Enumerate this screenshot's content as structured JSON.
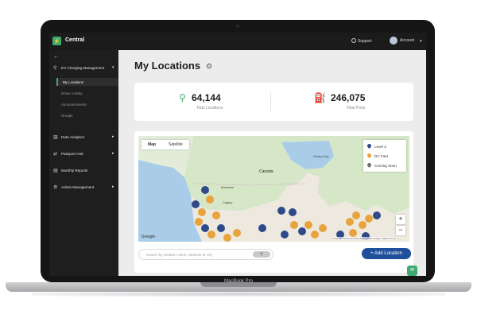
{
  "device": {
    "model_label": "MacBook Pro"
  },
  "app": {
    "name": "Central",
    "logo_glyph": "⚡"
  },
  "topbar": {
    "support_label": "Support",
    "account_label": "Account",
    "caret": "▾"
  },
  "sidebar": {
    "back_glyph": "←",
    "sections": [
      {
        "icon": "⚲",
        "label": "EV Charging Management",
        "caret": "▾"
      },
      {
        "icon": "▥",
        "label": "Data Analytics",
        "caret": "▸"
      },
      {
        "icon": "⇄",
        "label": "Passport Hub",
        "caret": "▸"
      },
      {
        "icon": "▤",
        "label": "Monthly Reports",
        "caret": ""
      },
      {
        "icon": "⚙",
        "label": "Admin Management",
        "caret": "▸"
      }
    ],
    "sub_items": [
      "My Locations",
      "Driver Activity",
      "Announcements",
      "Groups"
    ],
    "active_sub": "My Locations"
  },
  "page": {
    "title": "My Locations",
    "info_glyph": "i"
  },
  "stats": {
    "locations": {
      "value": "64,144",
      "label": "Total Locations",
      "icon": "⚲"
    },
    "ports": {
      "value": "246,075",
      "label": "Total Ports",
      "icon": "⛽"
    }
  },
  "map": {
    "tabs": [
      "Map",
      "Satellite"
    ],
    "active_tab": "Map",
    "labels": {
      "canada": "Canada",
      "hudson": "Hudson Bay",
      "edmonton": "Edmonton",
      "calgary": "Calgary"
    },
    "legend": [
      {
        "label": "Level 2",
        "color": "#2f4a8a"
      },
      {
        "label": "DC Fast",
        "color": "#e8a33d"
      },
      {
        "label": "Coming Soon",
        "color": "#6f6f6f"
      }
    ],
    "zoom_in": "+",
    "zoom_out": "−",
    "google_label": "Google",
    "attribution": "Keyboard shortcuts  Map data ©2024 Google, INEGI  Terms"
  },
  "search": {
    "placeholder": "Search by location name, address or city",
    "button_glyph": "⚲"
  },
  "add_location_label": "+ Add Location",
  "chat_glyph": "✉",
  "colors": {
    "accent": "#3daa6f",
    "primary_button": "#1e4f9b",
    "level2": "#2f4a8a",
    "dc_fast": "#e8a33d"
  }
}
